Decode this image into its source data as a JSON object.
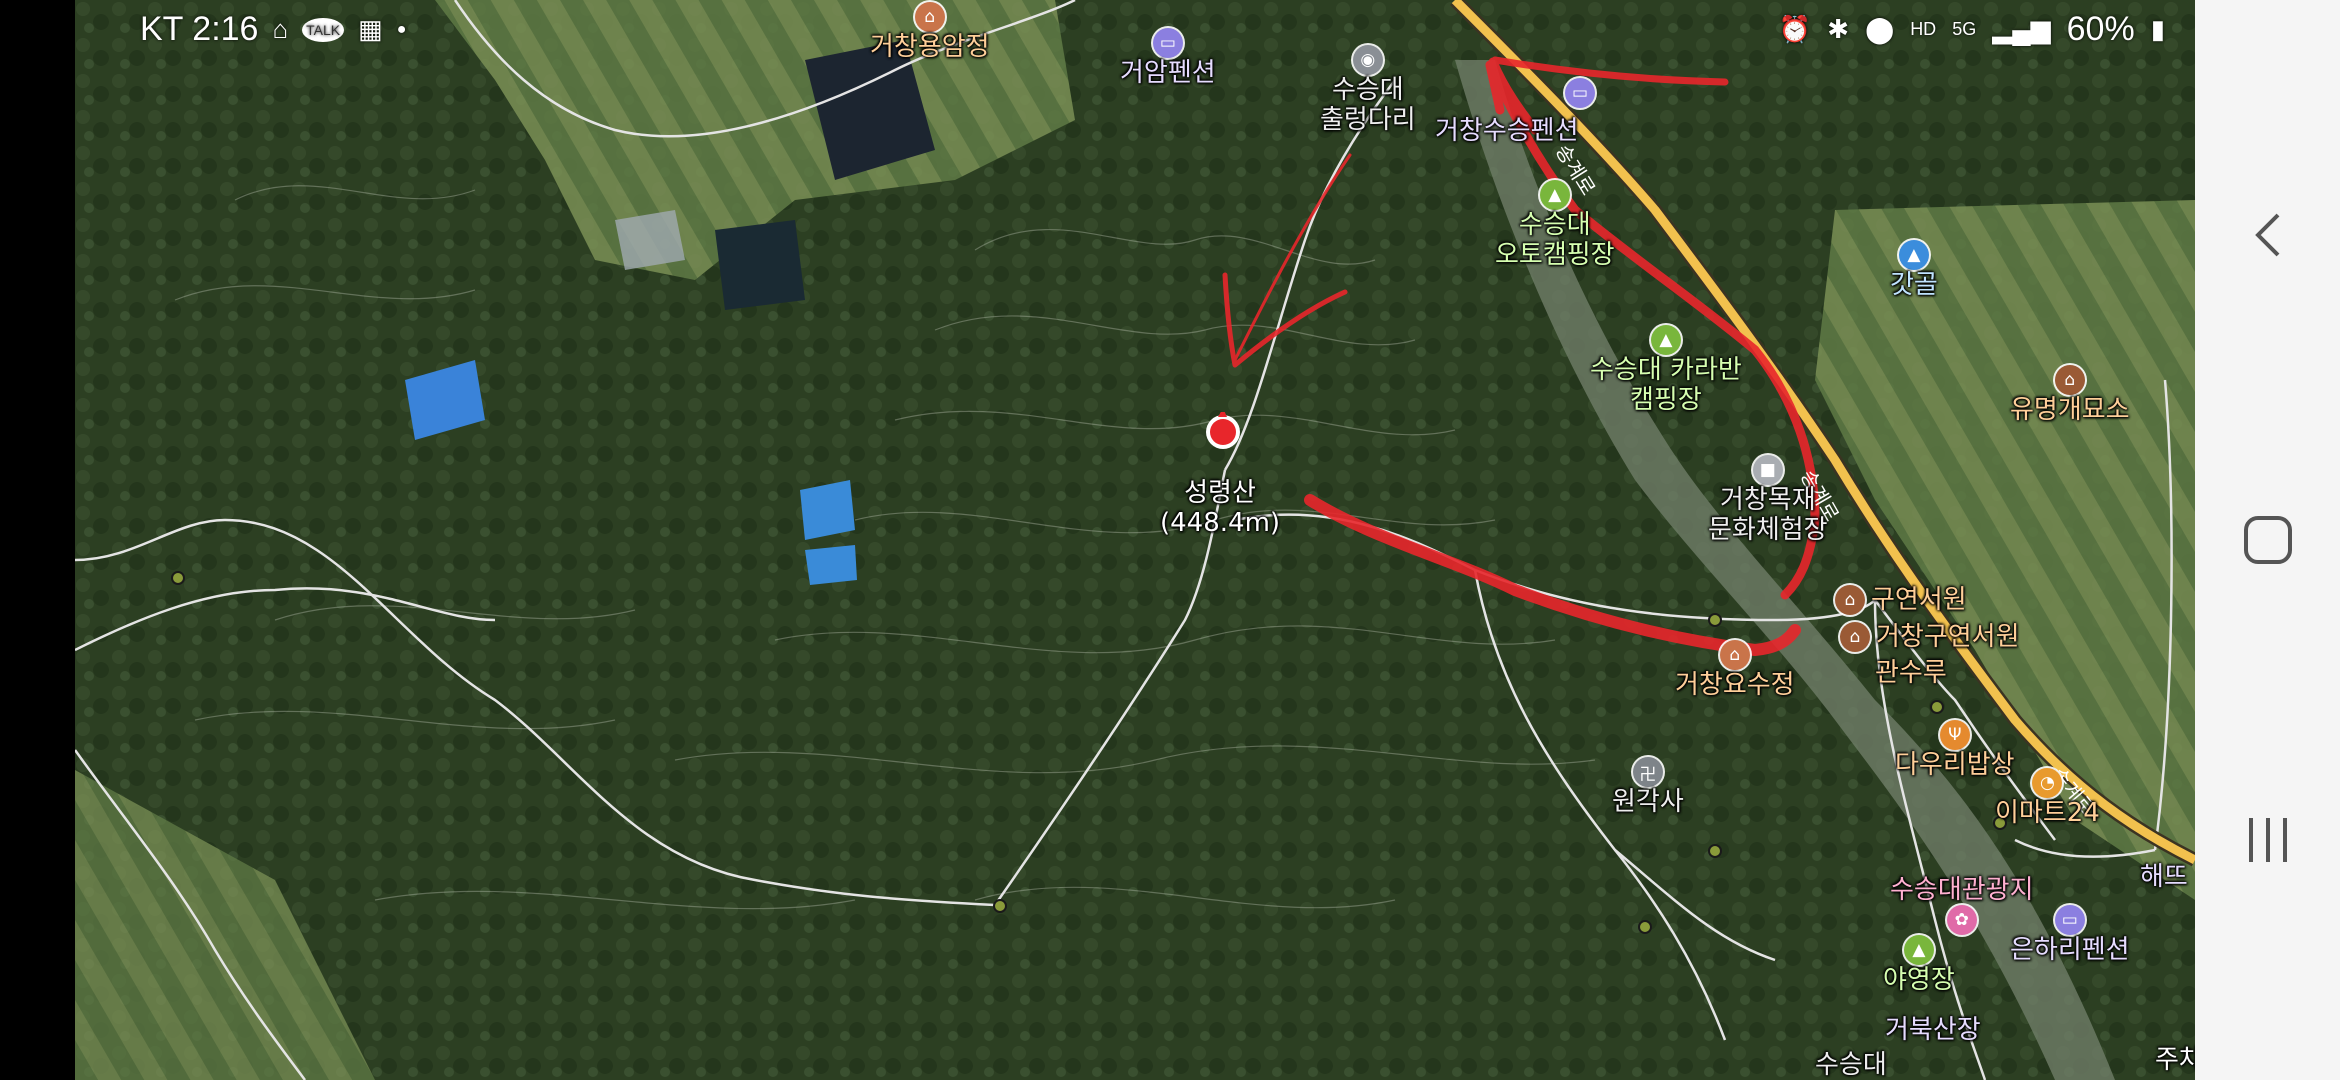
{
  "status_bar": {
    "carrier_time": "KT 2:16",
    "left_icons": [
      "home-icon",
      "talk-icon",
      "calendar-icon",
      "dot-icon"
    ],
    "right_icons": [
      "alarm-icon",
      "bluetooth-icon",
      "location-icon",
      "hd-voice-icon",
      "5g-icon",
      "signal-icon"
    ],
    "battery": "60%",
    "talk_badge": "TALK"
  },
  "map": {
    "summit": {
      "name": "성령산",
      "elevation": "(448.4m)"
    },
    "pois": [
      {
        "label": "거창용암정",
        "type": "heritage"
      },
      {
        "label": "거암펜션",
        "type": "lodging"
      },
      {
        "label": "수승대",
        "label2": "출렁다리",
        "type": "photo"
      },
      {
        "label": "거창수승펜션",
        "type": "lodging"
      },
      {
        "label": "수승대",
        "label2": "오토캠핑장",
        "type": "camping"
      },
      {
        "label": "수승대 카라반",
        "label2": "캠핑장",
        "type": "camping"
      },
      {
        "label": "갓골",
        "type": "village"
      },
      {
        "label": "유명개묘소",
        "type": "heritage"
      },
      {
        "label": "거창목재",
        "label2": "문화체험장",
        "type": "facility"
      },
      {
        "label": "구연서원",
        "type": "heritage"
      },
      {
        "label": "거창구연서원",
        "type": "heritage"
      },
      {
        "label": "관수루",
        "type": "heritage"
      },
      {
        "label": "거창요수정",
        "type": "heritage"
      },
      {
        "label": "원각사",
        "type": "temple"
      },
      {
        "label": "다우리밥상",
        "type": "restaurant"
      },
      {
        "label": "이마트24",
        "type": "store"
      },
      {
        "label": "수승대관광지",
        "type": "tourist"
      },
      {
        "label": "은하리펜션",
        "type": "lodging"
      },
      {
        "label": "야영장",
        "type": "camping"
      },
      {
        "label": "거북산장",
        "type": "lodging"
      },
      {
        "label": "수승대",
        "type": "place"
      },
      {
        "label": "해뜨",
        "type": "lodging"
      },
      {
        "label": "주차",
        "type": "parking"
      }
    ],
    "road_labels": [
      "송계로",
      "송계로",
      "송계로"
    ]
  },
  "navbar": {
    "back": "back-icon",
    "home": "home-button-icon",
    "recents": "recents-icon"
  },
  "colors": {
    "forest": "#2b3d22",
    "annotation_red": "#e8262b",
    "road_yellow": "#f2c14e",
    "trail_white": "#e8e8e8"
  }
}
